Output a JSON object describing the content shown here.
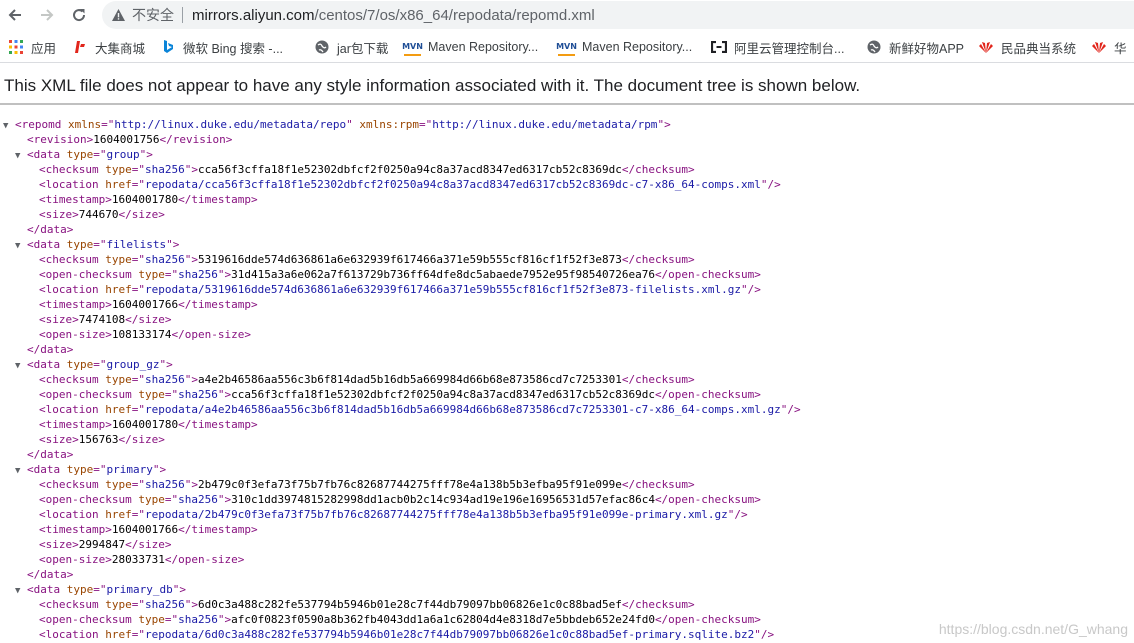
{
  "browser": {
    "not_secure": "不安全",
    "url_domain": "mirrors.aliyun.com",
    "url_path": "/centos/7/os/x86_64/repodata/repomd.xml",
    "bookmarks": [
      {
        "label": "应用",
        "icon": "apps-grid-icon"
      },
      {
        "label": "大集商城",
        "icon": "dajia-icon"
      },
      {
        "label": "微软 Bing 搜索 -...",
        "icon": "bing-icon"
      },
      {
        "label": "jar包下载",
        "icon": "globe-icon"
      },
      {
        "label": "Maven Repository...",
        "icon": "maven-icon"
      },
      {
        "label": "Maven Repository...",
        "icon": "maven-icon"
      },
      {
        "label": "阿里云管理控制台...",
        "icon": "aliyun-icon"
      },
      {
        "label": "新鲜好物APP",
        "icon": "globe-icon"
      },
      {
        "label": "民品典当系统",
        "icon": "huawei-icon"
      },
      {
        "label": "华",
        "icon": "huawei-icon"
      }
    ]
  },
  "page": {
    "notice": "This XML file does not appear to have any style information associated with it. The document tree is shown below."
  },
  "xml": {
    "root_open": {
      "tag": "repomd",
      "attrs": [
        [
          "xmlns",
          "http://linux.duke.edu/metadata/repo"
        ],
        [
          "xmlns:rpm",
          "http://linux.duke.edu/metadata/rpm"
        ]
      ]
    },
    "revision": "1604001756",
    "datas": [
      {
        "type": "group",
        "children": [
          {
            "tag": "checksum",
            "attrs": [
              [
                "type",
                "sha256"
              ]
            ],
            "text": "cca56f3cffa18f1e52302dbfcf2f0250a94c8a37acd8347ed6317cb52c8369dc"
          },
          {
            "tag": "location",
            "attrs": [
              [
                "href",
                "repodata/cca56f3cffa18f1e52302dbfcf2f0250a94c8a37acd8347ed6317cb52c8369dc-c7-x86_64-comps.xml"
              ]
            ],
            "self_close": true
          },
          {
            "tag": "timestamp",
            "text": "1604001780"
          },
          {
            "tag": "size",
            "text": "744670"
          }
        ]
      },
      {
        "type": "filelists",
        "children": [
          {
            "tag": "checksum",
            "attrs": [
              [
                "type",
                "sha256"
              ]
            ],
            "text": "5319616dde574d636861a6e632939f617466a371e59b555cf816cf1f52f3e873"
          },
          {
            "tag": "open-checksum",
            "attrs": [
              [
                "type",
                "sha256"
              ]
            ],
            "text": "31d415a3a6e062a7f613729b736ff64dfe8dc5abaede7952e95f98540726ea76"
          },
          {
            "tag": "location",
            "attrs": [
              [
                "href",
                "repodata/5319616dde574d636861a6e632939f617466a371e59b555cf816cf1f52f3e873-filelists.xml.gz"
              ]
            ],
            "self_close": true
          },
          {
            "tag": "timestamp",
            "text": "1604001766"
          },
          {
            "tag": "size",
            "text": "7474108"
          },
          {
            "tag": "open-size",
            "text": "108133174"
          }
        ]
      },
      {
        "type": "group_gz",
        "children": [
          {
            "tag": "checksum",
            "attrs": [
              [
                "type",
                "sha256"
              ]
            ],
            "text": "a4e2b46586aa556c3b6f814dad5b16db5a669984d66b68e873586cd7c7253301"
          },
          {
            "tag": "open-checksum",
            "attrs": [
              [
                "type",
                "sha256"
              ]
            ],
            "text": "cca56f3cffa18f1e52302dbfcf2f0250a94c8a37acd8347ed6317cb52c8369dc"
          },
          {
            "tag": "location",
            "attrs": [
              [
                "href",
                "repodata/a4e2b46586aa556c3b6f814dad5b16db5a669984d66b68e873586cd7c7253301-c7-x86_64-comps.xml.gz"
              ]
            ],
            "self_close": true
          },
          {
            "tag": "timestamp",
            "text": "1604001780"
          },
          {
            "tag": "size",
            "text": "156763"
          }
        ]
      },
      {
        "type": "primary",
        "children": [
          {
            "tag": "checksum",
            "attrs": [
              [
                "type",
                "sha256"
              ]
            ],
            "text": "2b479c0f3efa73f75b7fb76c82687744275fff78e4a138b5b3efba95f91e099e"
          },
          {
            "tag": "open-checksum",
            "attrs": [
              [
                "type",
                "sha256"
              ]
            ],
            "text": "310c1dd3974815282998dd1acb0b2c14c934ad19e196e16956531d57efac86c4"
          },
          {
            "tag": "location",
            "attrs": [
              [
                "href",
                "repodata/2b479c0f3efa73f75b7fb76c82687744275fff78e4a138b5b3efba95f91e099e-primary.xml.gz"
              ]
            ],
            "self_close": true
          },
          {
            "tag": "timestamp",
            "text": "1604001766"
          },
          {
            "tag": "size",
            "text": "2994847"
          },
          {
            "tag": "open-size",
            "text": "28033731"
          }
        ]
      },
      {
        "type": "primary_db",
        "children": [
          {
            "tag": "checksum",
            "attrs": [
              [
                "type",
                "sha256"
              ]
            ],
            "text": "6d0c3a488c282fe537794b5946b01e28c7f44db79097bb06826e1c0c88bad5ef"
          },
          {
            "tag": "open-checksum",
            "attrs": [
              [
                "type",
                "sha256"
              ]
            ],
            "text": "afc0f0823f0590a8b362fb4043dd1a6a1c62804d4e8318d7e5bbdeb652e24fd0"
          },
          {
            "tag": "location",
            "attrs": [
              [
                "href",
                "repodata/6d0c3a488c282fe537794b5946b01e28c7f44db79097bb06826e1c0c88bad5ef-primary.sqlite.bz2"
              ]
            ],
            "self_close": true
          }
        ]
      }
    ]
  },
  "watermark": "https://blog.csdn.net/G_whang"
}
